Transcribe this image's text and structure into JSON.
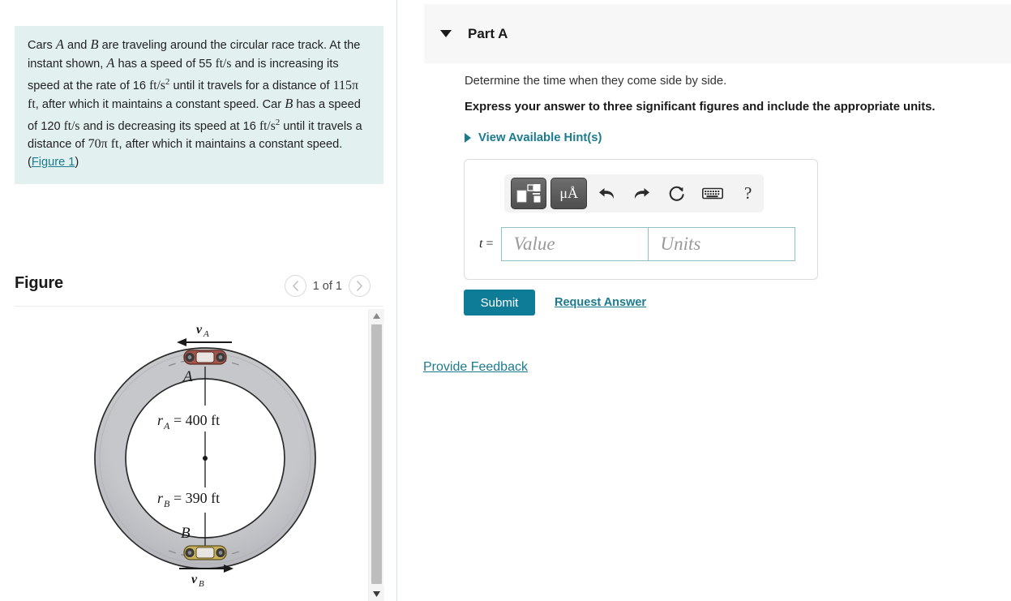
{
  "problem": {
    "segments": [
      {
        "t": "Cars ",
        "k": "plain"
      },
      {
        "t": "A",
        "k": "var"
      },
      {
        "t": " and ",
        "k": "plain"
      },
      {
        "t": "B",
        "k": "var"
      },
      {
        "t": " are traveling around the circular race track. At the instant shown, ",
        "k": "plain"
      },
      {
        "t": "A",
        "k": "var"
      },
      {
        "t": " has a speed of 55 ",
        "k": "plain"
      },
      {
        "t": "ft/s",
        "k": "unit"
      },
      {
        "t": " and is increasing its speed at the rate of 16 ",
        "k": "plain"
      },
      {
        "t": "ft/s",
        "k": "unit"
      },
      {
        "t": "2",
        "k": "sup"
      },
      {
        "t": " until it travels for a distance of ",
        "k": "plain"
      },
      {
        "t": "115π ft",
        "k": "num"
      },
      {
        "t": ", after which it maintains a constant speed. Car ",
        "k": "plain"
      },
      {
        "t": "B",
        "k": "var"
      },
      {
        "t": " has a speed of 120 ",
        "k": "plain"
      },
      {
        "t": "ft/s",
        "k": "unit"
      },
      {
        "t": " and is decreasing its speed at 16 ",
        "k": "plain"
      },
      {
        "t": "ft/s",
        "k": "unit"
      },
      {
        "t": "2",
        "k": "sup"
      },
      {
        "t": " until it travels a distance of ",
        "k": "plain"
      },
      {
        "t": "70π ft",
        "k": "num"
      },
      {
        "t": ", after which it maintains a constant speed. ",
        "k": "plain"
      }
    ],
    "figure_link_open": "(",
    "figure_link": "Figure 1",
    "figure_link_close": ")",
    "background_color": "#e2f1ef"
  },
  "figure_panel": {
    "title": "Figure",
    "pager": {
      "prev_icon": "chevron-left-icon",
      "next_icon": "chevron-right-icon",
      "label": "1 of 1"
    },
    "scrollbar": {
      "up_icon": "scroll-up-arrow-icon",
      "down_icon": "scroll-down-arrow-icon"
    },
    "diagram": {
      "type": "circular-race-track",
      "outer_label_a": "A",
      "outer_label_b": "B",
      "velocity_a": "v",
      "velocity_a_sub": "A",
      "velocity_b": "v",
      "velocity_b_sub": "B",
      "radius_a_label": "r",
      "radius_a_sub": "A",
      "radius_a_value": "= 400 ft",
      "radius_b_label": "r",
      "radius_b_sub": "B",
      "radius_b_value": "= 390 ft",
      "track_fill": "#c2c3c7",
      "car_a_color": "#a4554a",
      "car_b_color": "#c9b05a"
    }
  },
  "part": {
    "caret_icon": "triangle-down-icon",
    "title": "Part A",
    "prompt": "Determine the time when they come side by side.",
    "instruction": "Express your answer to three significant figures and include the appropriate units.",
    "hints": {
      "caret_icon": "triangle-right-icon",
      "label": "View Available Hint(s)"
    }
  },
  "answer": {
    "toolbar": [
      {
        "name": "template-formula-icon",
        "kind": "dark-template"
      },
      {
        "name": "units-micro-angstrom-icon",
        "kind": "dark-text",
        "label": "μÅ"
      },
      {
        "name": "undo-icon",
        "kind": "plain"
      },
      {
        "name": "redo-icon",
        "kind": "plain"
      },
      {
        "name": "reset-icon",
        "kind": "plain"
      },
      {
        "name": "keyboard-icon",
        "kind": "plain"
      },
      {
        "name": "help-icon",
        "kind": "plain-help",
        "label": "?"
      }
    ],
    "equation_label": "t",
    "equation_equals": " = ",
    "value_placeholder": "Value",
    "value_text": "",
    "units_placeholder": "Units",
    "units_text": "",
    "border_color": "#8fc2c8"
  },
  "actions": {
    "submit_label": "Submit",
    "submit_color": "#0e7c96",
    "request_answer_label": "Request Answer",
    "provide_feedback_label": "Provide Feedback",
    "link_color": "#1b7b8c"
  }
}
